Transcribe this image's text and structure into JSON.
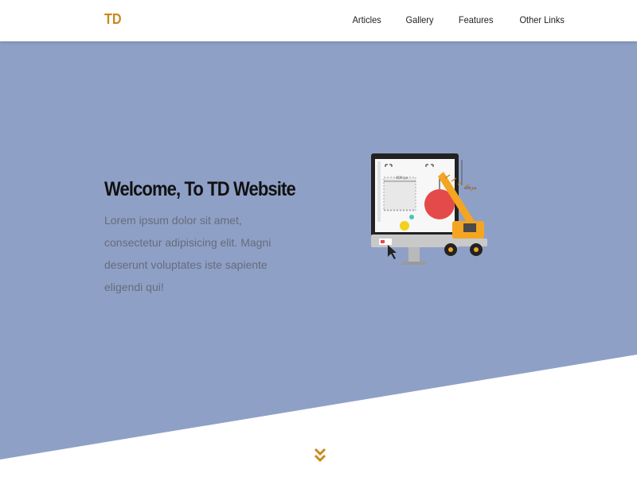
{
  "header": {
    "logo": "TD",
    "nav": [
      "Articles",
      "Gallery",
      "Features",
      "Other Links"
    ]
  },
  "hero": {
    "title": "Welcome, To TD Website",
    "body": "Lorem ipsum dolor sit amet, consectetur adipisicing elit. Magni deserunt voluptates iste sapiente eligendi qui!",
    "illustration": {
      "width_label": "400 px",
      "height_label": "600 px"
    }
  },
  "colors": {
    "hero_bg": "#8fa0c7",
    "brand": "#c98a1e",
    "crane": "#f4a521"
  },
  "icons": {
    "scroll": "double-chevron-down-icon"
  }
}
